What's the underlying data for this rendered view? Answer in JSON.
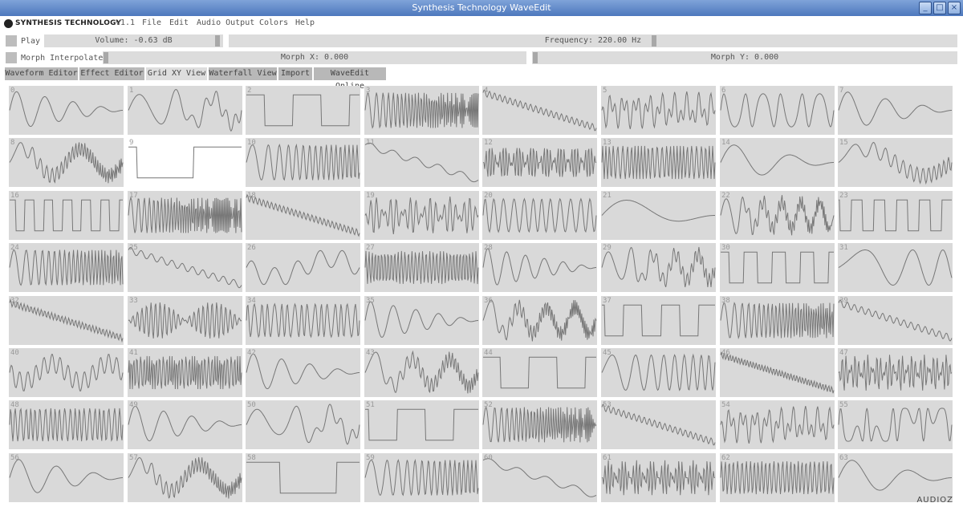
{
  "window": {
    "title": "Synthesis Technology WaveEdit",
    "buttons": [
      "minimize-icon",
      "maximize-icon",
      "close-icon"
    ]
  },
  "menubar": {
    "logo_text": "SYNTHESIS TECHNOLOGY",
    "version": "v1.1",
    "items": [
      "File",
      "Edit",
      "Audio Output",
      "Colors",
      "Help"
    ]
  },
  "controls": {
    "play_label": "Play",
    "volume_text": "Volume: -0.63 dB",
    "frequency_text": "Frequency: 220.00 Hz",
    "morph_interpolate_label": "Morph Interpolate",
    "morph_x_text": "Morph X: 0.000",
    "morph_y_text": "Morph Y: 0.000"
  },
  "tabs": [
    "Waveform Editor",
    "Effect Editor",
    "Grid XY View",
    "Waterfall View",
    "Import",
    "WaveEdit Online"
  ],
  "active_tab": "Grid XY View",
  "grid": {
    "columns": 8,
    "rows": 8,
    "selected_index": 9,
    "labels": [
      "0",
      "1",
      "2",
      "3",
      "4",
      "5",
      "6",
      "7",
      "8",
      "9",
      "10",
      "11",
      "12",
      "13",
      "14",
      "15",
      "16",
      "17",
      "18",
      "19",
      "20",
      "21",
      "22",
      "23",
      "24",
      "25",
      "26",
      "27",
      "28",
      "29",
      "30",
      "31",
      "32",
      "33",
      "34",
      "35",
      "36",
      "37",
      "38",
      "39",
      "40",
      "41",
      "42",
      "43",
      "44",
      "45",
      "46",
      "47",
      "48",
      "49",
      "50",
      "51",
      "52",
      "53",
      "54",
      "55",
      "56",
      "57",
      "58",
      "59",
      "60",
      "61",
      "62",
      "63"
    ]
  },
  "watermark": "AUDIOZ",
  "colors": {
    "cell_bg": "#d9d9d9",
    "wave": "#777777",
    "selected_bg": "#ffffff"
  }
}
